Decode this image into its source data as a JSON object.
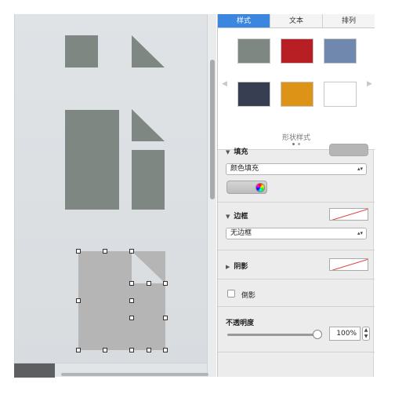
{
  "tabs": [
    {
      "label": "样式"
    },
    {
      "label": "文本"
    },
    {
      "label": "排列"
    }
  ],
  "styles": {
    "label": "形状样式",
    "swatches": [
      "#7f8782",
      "#b81f24",
      "#7088ad",
      "#373e51",
      "#dd9315",
      "#ffffff"
    ]
  },
  "fill": {
    "heading": "填充",
    "type": "颜色填充",
    "well_color": "#b5b5b5"
  },
  "border": {
    "heading": "边框",
    "type": "无边框"
  },
  "shadow": {
    "heading": "阴影"
  },
  "reflection": {
    "label": "倒影"
  },
  "opacity": {
    "heading": "不透明度",
    "value": "100%",
    "fraction": 1.0
  },
  "colors": {
    "accent": "#3b86de",
    "shape_gray": "#7f8782",
    "selected_gray": "#b5b5b5"
  }
}
